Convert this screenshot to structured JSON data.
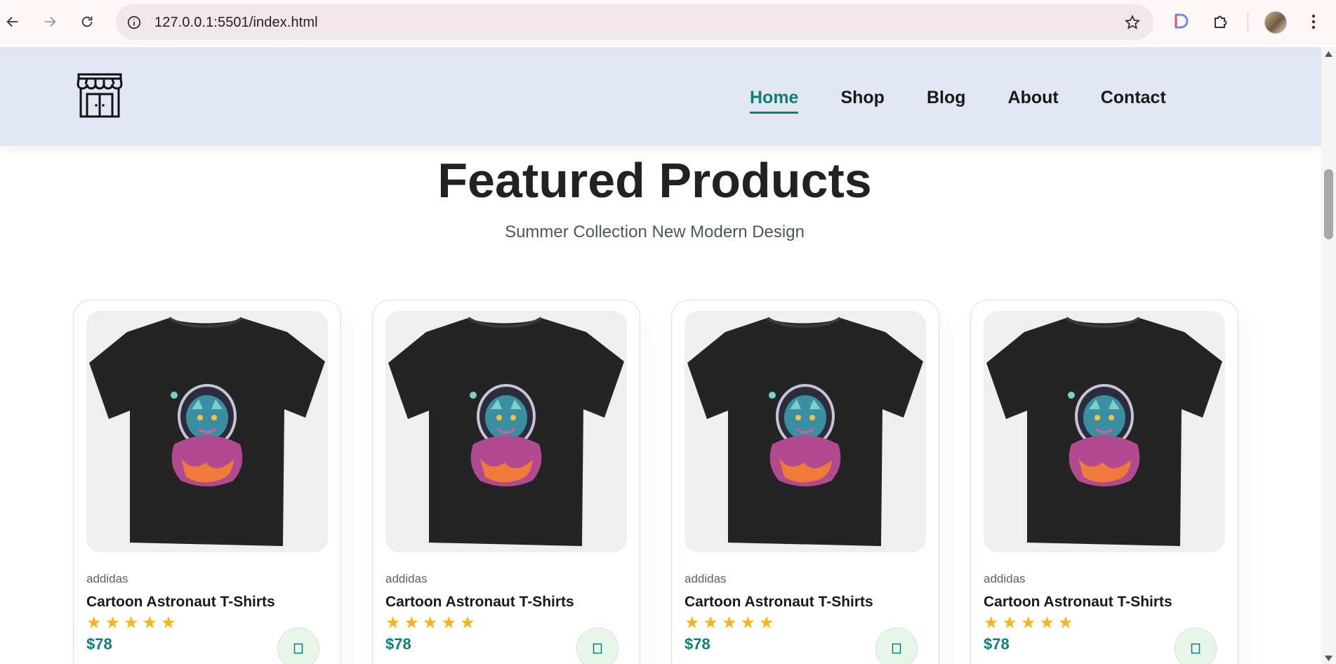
{
  "browser": {
    "url": "127.0.0.1:5501/index.html",
    "icons": [
      "back-arrow-icon",
      "forward-arrow-icon",
      "reload-icon",
      "info-icon",
      "bookmark-star-icon",
      "extension-d-icon",
      "extensions-puzzle-icon",
      "profile-avatar",
      "kebab-menu-icon"
    ]
  },
  "header": {
    "logo_icon": "storefront-icon",
    "nav": [
      {
        "label": "Home",
        "active": true
      },
      {
        "label": "Shop",
        "active": false
      },
      {
        "label": "Blog",
        "active": false
      },
      {
        "label": "About",
        "active": false
      },
      {
        "label": "Contact",
        "active": false
      }
    ]
  },
  "featured": {
    "title": "Featured Products",
    "subtitle": "Summer Collection New Modern Design",
    "products": [
      {
        "brand": "addidas",
        "name": "Cartoon Astronaut T-Shirts",
        "rating": 5,
        "price": "$78",
        "image_icon": "astronaut-cat-tshirt-image",
        "cart_icon": "cart-icon"
      },
      {
        "brand": "addidas",
        "name": "Cartoon Astronaut T-Shirts",
        "rating": 5,
        "price": "$78",
        "image_icon": "astronaut-cat-tshirt-image",
        "cart_icon": "cart-icon"
      },
      {
        "brand": "addidas",
        "name": "Cartoon Astronaut T-Shirts",
        "rating": 5,
        "price": "$78",
        "image_icon": "astronaut-cat-tshirt-image",
        "cart_icon": "cart-icon"
      },
      {
        "brand": "addidas",
        "name": "Cartoon Astronaut T-Shirts",
        "rating": 5,
        "price": "$78",
        "image_icon": "astronaut-cat-tshirt-image",
        "cart_icon": "cart-icon"
      }
    ]
  },
  "colors": {
    "accent": "#088178",
    "header_bg": "#e3e6f3",
    "star": "#f3b519"
  }
}
